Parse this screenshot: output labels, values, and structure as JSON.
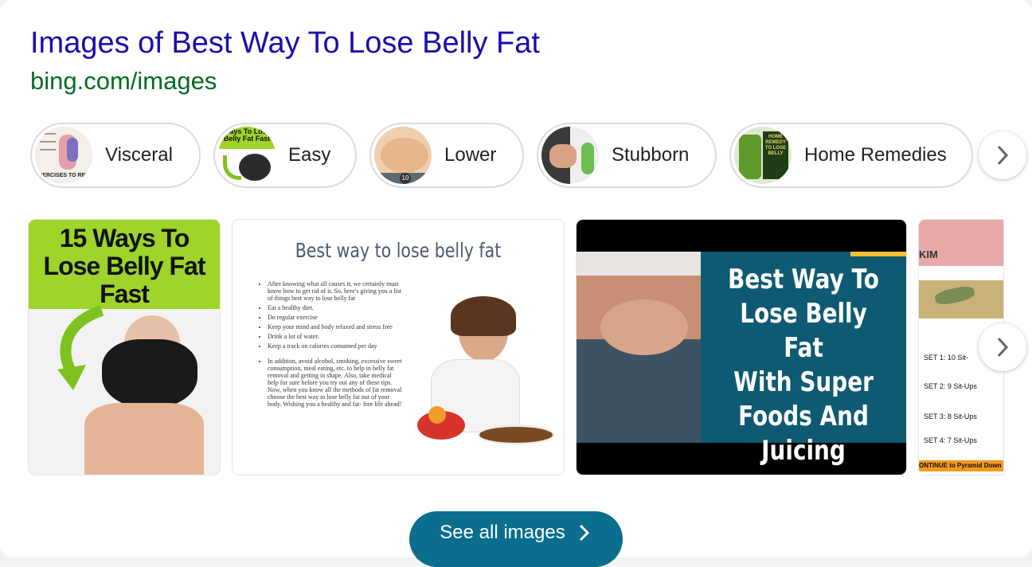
{
  "header": {
    "title": "Images of Best Way To Lose Belly Fat",
    "url": "bing.com/images"
  },
  "chips": [
    {
      "label": "Visceral",
      "thumb_icon": "diagram-thumbnail",
      "thumb_text": "EXERCISES TO REDUC"
    },
    {
      "label": "Easy",
      "thumb_icon": "fitness-thumbnail",
      "thumb_text": "Ways To Lose Belly Fat Fast"
    },
    {
      "label": "Lower",
      "thumb_icon": "belly-thumbnail",
      "thumb_text": "10"
    },
    {
      "label": "Stubborn",
      "thumb_icon": "body-thumbnail"
    },
    {
      "label": "Home Remedies",
      "thumb_icon": "juice-thumbnail",
      "thumb_text": "HOME REMEDY TO LOSE BELLY"
    }
  ],
  "images": [
    {
      "name": "fifteen-ways",
      "lines": [
        "15 Ways To",
        "Lose Belly Fat",
        "Fast"
      ],
      "accent": "#9fd42a"
    },
    {
      "name": "best-way-slide",
      "heading": "Best way to lose belly fat",
      "bullets": [
        "After knowing what all causes it, we certainly must know how to get rid of it. So, here's giving you a list of things best way to lose belly fat",
        "Eat a healthy diet.",
        "Do regular exercise",
        "Keep your mind and body relaxed and stress free",
        "Drink a lot of water.",
        "Keep a track on calories consumed per day"
      ],
      "paragraph": "In addition, avoid alcohol, smoking, excessive sweet consumption, meal eating, etc. to help in belly fat removal and getting in shape. Also, take medical help for sure before you try out any of these tips. Now, when you know all the methods of fat removal choose the best way to lose belly fat out of your body. Wishing you a healthy and fat- free life ahead!"
    },
    {
      "name": "super-foods",
      "lines": [
        "Best Way To",
        "Lose Belly Fat",
        "With Super",
        "Foods And",
        "Juicing"
      ],
      "panel_color": "#0f5a73"
    },
    {
      "name": "sit-ups",
      "logo": "KIM",
      "sets": [
        "SET 1:   10 Sit-",
        "SET 2:   9 Sit-Ups",
        "SET 3:   8 Sit-Ups",
        "SET 4:   7 Sit-Ups"
      ],
      "footer": "ONTINUE to Pyramid Down"
    }
  ],
  "buttons": {
    "see_all": "See all images"
  },
  "colors": {
    "link": "#1a0dab",
    "url": "#006d21",
    "see_all_bg": "#0b6e8f"
  }
}
